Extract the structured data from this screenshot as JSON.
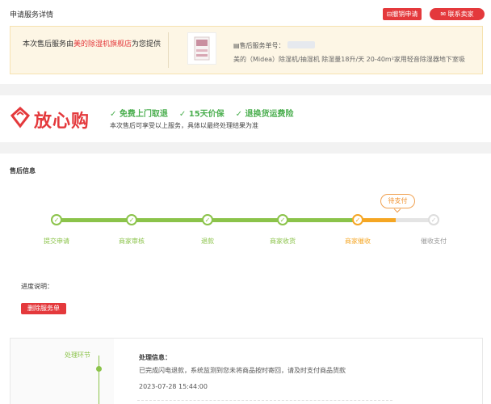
{
  "header": {
    "title": "申请服务详情",
    "cancel_label": "撤销申请",
    "contact_label": "联系卖家"
  },
  "banner": {
    "prefix": "本次售后服务由",
    "store": "美的除湿机旗舰店",
    "suffix": "为您提供",
    "service_no_label": "售后服务单号：",
    "product_name": "美的（Midea）除湿机/抽湿机 除湿量18升/天 20-40m²家用轻音除湿器地下室吸"
  },
  "fangxin": {
    "logo_text": "放心购",
    "items": [
      "✓ 免费上门取退",
      "✓ 15天价保",
      "✓ 退换货运费险"
    ],
    "note": "本次售后可享受以上服务，具体以最终处理结果为准"
  },
  "info": {
    "title": "售后信息",
    "pending_badge": "待支付",
    "steps": [
      {
        "label": "提交申请",
        "state": "done"
      },
      {
        "label": "商家审核",
        "state": "done"
      },
      {
        "label": "退款",
        "state": "done"
      },
      {
        "label": "商家收货",
        "state": "done"
      },
      {
        "label": "商家催收",
        "state": "current"
      },
      {
        "label": "催收支付",
        "state": "todo"
      }
    ],
    "progress_label": "进度说明：",
    "delete_label": "删除服务单"
  },
  "process": {
    "left_label": "处理环节",
    "heading": "处理信息：",
    "desc": "已完成闪电退款，系统监测到您未将商品按时寄回，请及时支付商品货款",
    "time": "2023-07-28 15:44:00"
  },
  "colors": {
    "accent_red": "#e4393c",
    "progress_green": "#8bc34a",
    "progress_orange": "#f5a623"
  }
}
